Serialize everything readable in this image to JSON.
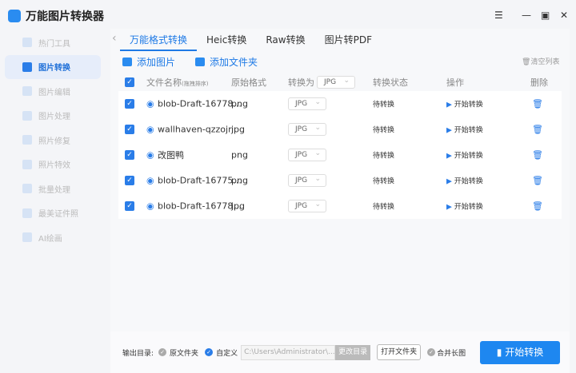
{
  "app": {
    "title": "万能图片转换器"
  },
  "sidebar": {
    "items": [
      {
        "label": "热门工具"
      },
      {
        "label": "图片转换"
      },
      {
        "label": "图片编辑"
      },
      {
        "label": "图片处理"
      },
      {
        "label": "照片修复"
      },
      {
        "label": "照片特效"
      },
      {
        "label": "批量处理"
      },
      {
        "label": "最美证件照"
      },
      {
        "label": "AI绘画"
      }
    ]
  },
  "tabs": [
    {
      "label": "万能格式转换"
    },
    {
      "label": "Heic转换"
    },
    {
      "label": "Raw转换"
    },
    {
      "label": "图片转PDF"
    }
  ],
  "toolbar": {
    "add_image": "添加图片",
    "add_folder": "添加文件夹",
    "clear_list": "清空列表"
  },
  "table": {
    "headers": {
      "name": "文件名称",
      "name_hint": "(拖拽排序)",
      "format": "原始格式",
      "convert_to": "转换为",
      "convert_value": "JPG",
      "status": "转换状态",
      "action": "操作",
      "delete": "删除"
    },
    "rows": [
      {
        "name": "blob-Draft-16778...",
        "format": "png",
        "target": "JPG",
        "status": "待转换",
        "action": "开始转换"
      },
      {
        "name": "wallhaven-qzzojr",
        "format": "jpg",
        "target": "JPG",
        "status": "待转换",
        "action": "开始转换"
      },
      {
        "name": "改图鸭",
        "format": "png",
        "target": "JPG",
        "status": "待转换",
        "action": "开始转换"
      },
      {
        "name": "blob-Draft-16775...",
        "format": "png",
        "target": "JPG",
        "status": "待转换",
        "action": "开始转换"
      },
      {
        "name": "blob-Draft-16778...",
        "format": "jpg",
        "target": "JPG",
        "status": "待转换",
        "action": "开始转换"
      }
    ]
  },
  "footer": {
    "output_label": "输出目录:",
    "original_folder": "原文件夹",
    "custom": "自定义",
    "path": "C:\\Users\\Administrator\\...",
    "change_dir": "更改目录",
    "open_folder": "打开文件夹",
    "merge": "合并长图",
    "start": "开始转换"
  },
  "colors": {
    "accent": "#1e7ae6"
  }
}
